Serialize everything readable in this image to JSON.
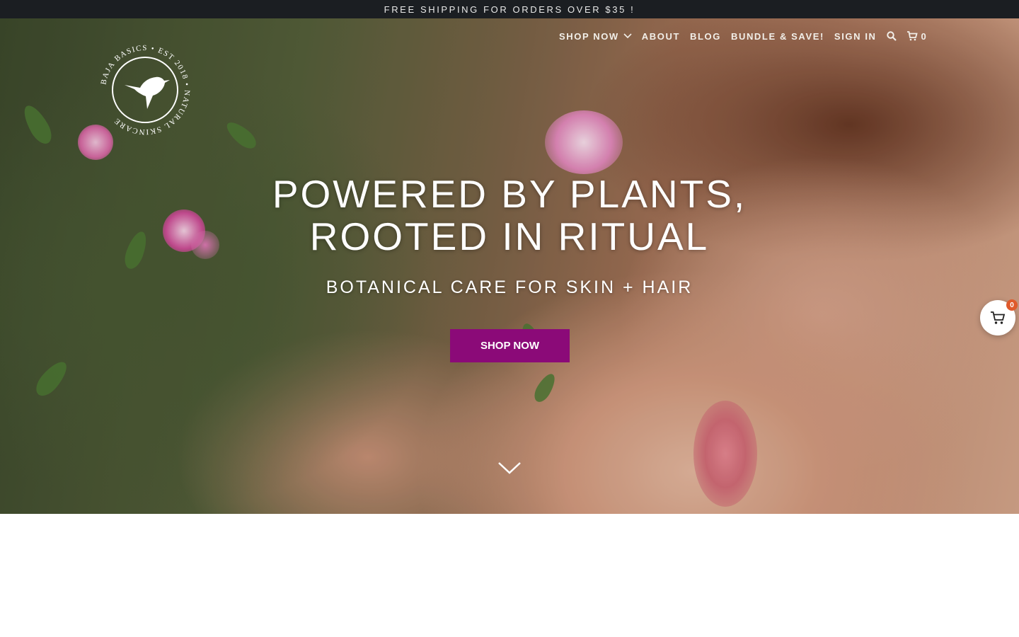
{
  "announcement": {
    "text": "FREE SHIPPING FOR ORDERS OVER $35 !"
  },
  "brand": {
    "logo_text": "BAJA BASICS • EST 2018 • NATURAL SKINCARE",
    "icon": "hummingbird-icon"
  },
  "nav": {
    "items": [
      {
        "label": "SHOP NOW",
        "has_dropdown": true
      },
      {
        "label": "ABOUT"
      },
      {
        "label": "BLOG"
      },
      {
        "label": "BUNDLE & SAVE!"
      },
      {
        "label": "SIGN IN"
      }
    ],
    "search_icon": "search-icon",
    "cart_icon": "cart-icon",
    "cart_count": "0"
  },
  "hero": {
    "headline_line1": "POWERED BY PLANTS,",
    "headline_line2": "ROOTED IN RITUAL",
    "subheadline": "BOTANICAL CARE FOR SKIN + HAIR",
    "cta_label": "SHOP NOW",
    "scroll_icon": "chevron-down-icon"
  },
  "floating_cart": {
    "count": "0",
    "icon": "cart-icon"
  },
  "colors": {
    "announcement_bg": "#1b1e22",
    "cta_bg": "#8b0a78",
    "badge": "#e05a2b"
  }
}
